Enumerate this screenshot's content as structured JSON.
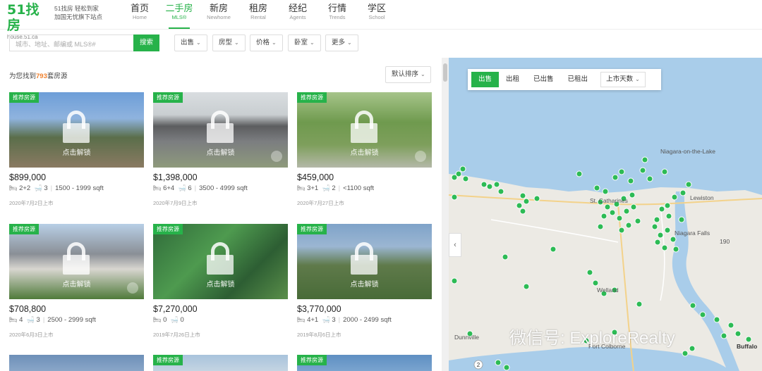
{
  "header": {
    "logo_text": "51找房",
    "logo_sub": "house.51.ca",
    "slogan_line1": "51找房 轻松到家",
    "slogan_line2": "加国无忧旗下站点",
    "nav": [
      {
        "zh": "首页",
        "en": "Home"
      },
      {
        "zh": "二手房",
        "en": "MLS®"
      },
      {
        "zh": "新房",
        "en": "Newhome"
      },
      {
        "zh": "租房",
        "en": "Rental"
      },
      {
        "zh": "经纪",
        "en": "Agents"
      },
      {
        "zh": "行情",
        "en": "Trends"
      },
      {
        "zh": "学区",
        "en": "School"
      }
    ]
  },
  "search": {
    "placeholder": "城市、地址、邮编或 MLS®#",
    "button": "搜索",
    "filters": [
      "出售",
      "房型",
      "价格",
      "卧室",
      "更多"
    ]
  },
  "results": {
    "prefix": "为您找到",
    "count": "793",
    "suffix": "套房源",
    "sort": "默认排序"
  },
  "listings": [
    {
      "tag": "推荐房源",
      "unlock": "点击解锁",
      "price": "$899,000",
      "beds": "2+2",
      "baths": "3",
      "sqft": "1500 - 1999 sqft",
      "date": "2020年7月2日上市"
    },
    {
      "tag": "推荐房源",
      "unlock": "点击解锁",
      "price": "$1,398,000",
      "beds": "6+4",
      "baths": "6",
      "sqft": "3500 - 4999 sqft",
      "date": "2020年7月9日上市"
    },
    {
      "tag": "推荐房源",
      "unlock": "点击解锁",
      "price": "$459,000",
      "beds": "3+1",
      "baths": "2",
      "sqft": "<1100 sqft",
      "date": "2020年7月27日上市"
    },
    {
      "tag": "推荐房源",
      "unlock": "点击解锁",
      "price": "$708,800",
      "beds": "4",
      "baths": "3",
      "sqft": "2500 - 2999 sqft",
      "date": "2020年6月3日上市"
    },
    {
      "tag": "推荐房源",
      "unlock": "点击解锁",
      "price": "$7,270,000",
      "beds": "0",
      "baths": "0",
      "sqft": "",
      "date": "2019年7月26日上市"
    },
    {
      "tag": "推荐房源",
      "unlock": "点击解锁",
      "price": "$3,770,000",
      "beds": "4+1",
      "baths": "3",
      "sqft": "2000 - 2499 sqft",
      "date": "2019年8月6日上市"
    },
    {
      "tag": "推荐房源"
    },
    {
      "tag": "推荐房源"
    },
    {
      "tag": "推荐房源"
    }
  ],
  "map": {
    "tabs": [
      "出售",
      "出租",
      "已出售",
      "已租出"
    ],
    "days": "上市天数",
    "labels": {
      "niagara_lake": "Niagara-on-the-Lake",
      "st_catharines": "St. Catharines",
      "lewiston": "Lewiston",
      "niagara_falls": "Niagara Falls",
      "welland": "Welland",
      "dunnville": "Dunnville",
      "port_colborne": "Port Colborne",
      "buffalo": "Buffalo",
      "route": "190"
    },
    "cluster_count": "2"
  },
  "watermark": "微信号: ExploreRealty",
  "colors": {
    "brand": "#27b24a",
    "accent": "#f0802c"
  }
}
